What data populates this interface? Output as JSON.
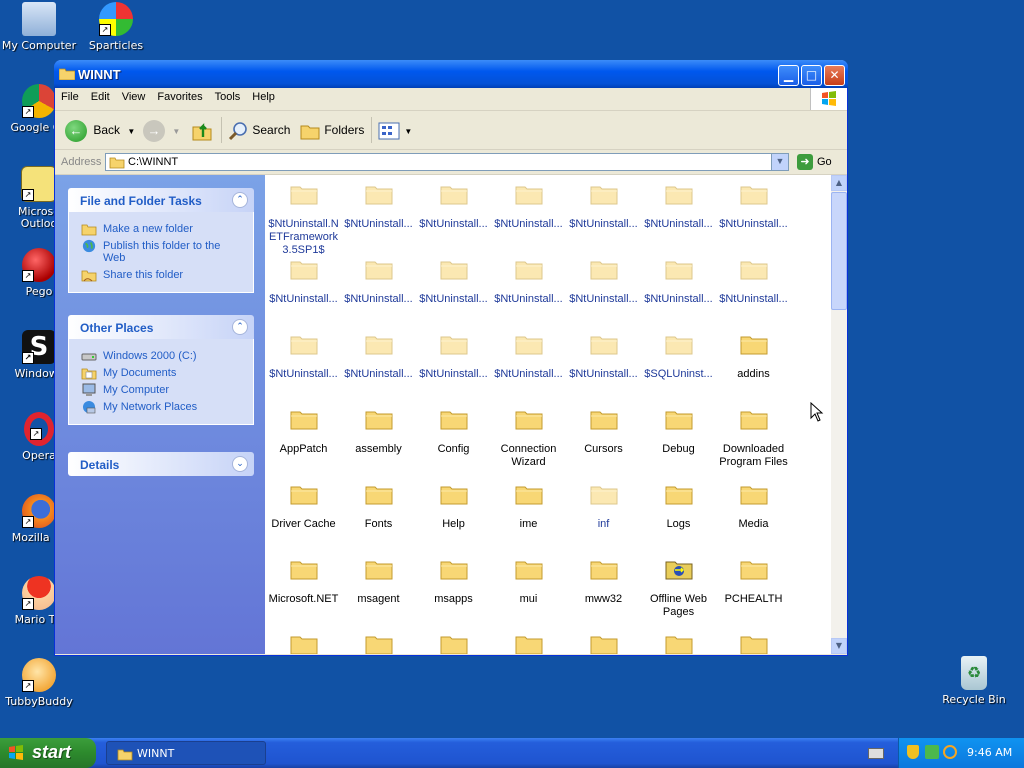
{
  "desktop": {
    "icons": [
      {
        "label": "My Computer",
        "icon": "my-computer-icon"
      },
      {
        "label": "Sparticles",
        "icon": "sparticles-icon"
      },
      {
        "label": "Google Ch",
        "icon": "google-chrome-icon"
      },
      {
        "label": "Microso",
        "label2": "Outloo",
        "icon": "outlook-icon"
      },
      {
        "label": "Pego",
        "icon": "pego-icon"
      },
      {
        "label": "Windows",
        "icon": "windows-s-icon"
      },
      {
        "label": "Opera",
        "icon": "opera-icon"
      },
      {
        "label": "Mozilla Fir",
        "icon": "firefox-icon"
      },
      {
        "label": "Mario Tei",
        "icon": "mario-icon"
      },
      {
        "label": "TubbyBuddy",
        "icon": "tubbybuddy-icon"
      },
      {
        "label": "Recycle Bin",
        "icon": "recycle-bin-icon"
      }
    ]
  },
  "window": {
    "title": "WINNT",
    "menu": [
      "File",
      "Edit",
      "View",
      "Favorites",
      "Tools",
      "Help"
    ],
    "toolbar": {
      "back": "Back",
      "search": "Search",
      "folders": "Folders"
    },
    "address": {
      "label": "Address",
      "value": "C:\\WINNT",
      "go": "Go"
    },
    "taskpane": {
      "file_tasks": {
        "title": "File and Folder Tasks",
        "links": [
          "Make a new folder",
          "Publish this folder to the Web",
          "Share this folder"
        ]
      },
      "other_places": {
        "title": "Other Places",
        "links": [
          "Windows 2000 (C:)",
          "My Documents",
          "My Computer",
          "My Network Places"
        ]
      },
      "details": {
        "title": "Details"
      }
    },
    "files": [
      "$NtUninstall.NETFramework3.5SP1$",
      "$NtUninstall...",
      "$NtUninstall...",
      "$NtUninstall...",
      "$NtUninstall...",
      "$NtUninstall...",
      "$NtUninstall...",
      "$NtUninstall...",
      "$NtUninstall...",
      "$NtUninstall...",
      "$NtUninstall...",
      "$NtUninstall...",
      "$NtUninstall...",
      "$NtUninstall...",
      "$NtUninstall...",
      "$NtUninstall...",
      "$NtUninstall...",
      "$NtUninstall...",
      "$NtUninstall...",
      "$SQLUninst...",
      "addins",
      "AppPatch",
      "assembly",
      "Config",
      "Connection Wizard",
      "Cursors",
      "Debug",
      "Downloaded Program Files",
      "Driver Cache",
      "Fonts",
      "Help",
      "ime",
      "inf",
      "Logs",
      "Media",
      "Microsoft.NET",
      "msagent",
      "msapps",
      "mui",
      "mww32",
      "Offline Web Pages",
      "PCHEALTH"
    ]
  },
  "taskbar": {
    "start": "start",
    "items": [
      {
        "label": "WINNT"
      }
    ],
    "clock": "9:46 AM"
  }
}
